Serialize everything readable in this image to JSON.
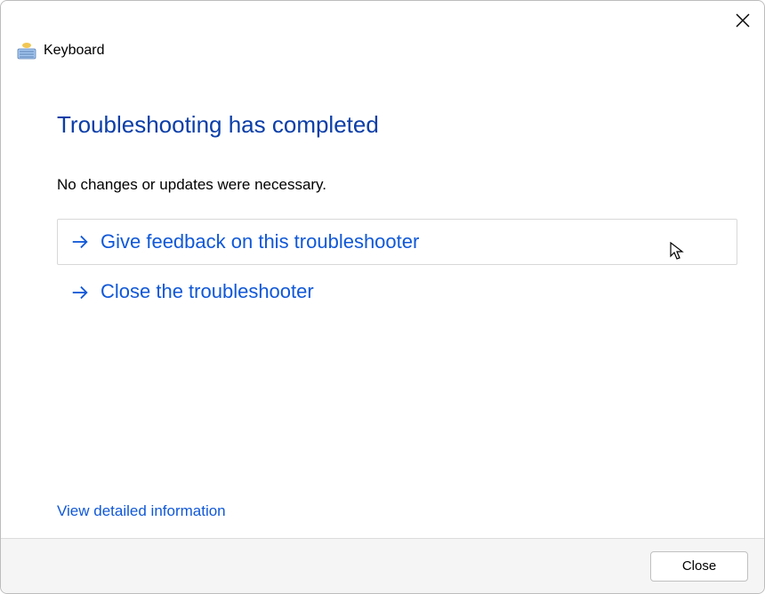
{
  "header": {
    "icon": "keyboard-icon",
    "label": "Keyboard"
  },
  "main": {
    "heading": "Troubleshooting has completed",
    "subtext": "No changes or updates were necessary.",
    "options": [
      {
        "label": "Give feedback on this troubleshooter",
        "highlight": true
      },
      {
        "label": "Close the troubleshooter",
        "highlight": false
      }
    ],
    "detail_link": "View detailed information"
  },
  "footer": {
    "close_label": "Close"
  },
  "colors": {
    "link": "#1058d8",
    "heading": "#0a3ea8"
  }
}
